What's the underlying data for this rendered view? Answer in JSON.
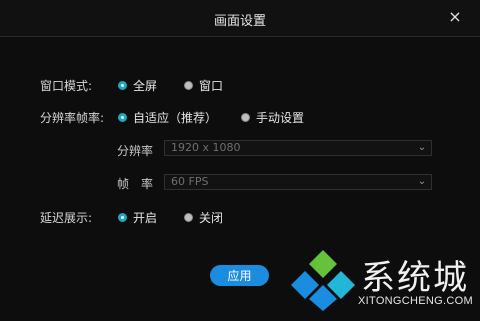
{
  "window": {
    "title": "画面设置",
    "close_icon": "×"
  },
  "settings": {
    "window_mode": {
      "label": "窗口模式:",
      "options": [
        "全屏",
        "窗口"
      ],
      "selected": "全屏"
    },
    "resolution_rate": {
      "label": "分辨率帧率:",
      "options": [
        "自适应（推荐）",
        "手动设置"
      ],
      "selected": "自适应（推荐）"
    },
    "resolution": {
      "label": "分辨率",
      "value": "1920 x 1080"
    },
    "frame_rate": {
      "label": "帧　率",
      "value": "60 FPS"
    },
    "delay_display": {
      "label": "延迟展示:",
      "options": [
        "开启",
        "关闭"
      ],
      "selected": "开启"
    }
  },
  "actions": {
    "apply_label": "应用"
  },
  "watermark": {
    "text": "系统城",
    "url": "XITONGCHENG.COM"
  },
  "colors": {
    "accent": "#1fa7c7",
    "button": "#1b8de0",
    "logo_green": "#66c23a",
    "logo_blue": "#1b8de0",
    "logo_teal": "#21b7d6"
  }
}
